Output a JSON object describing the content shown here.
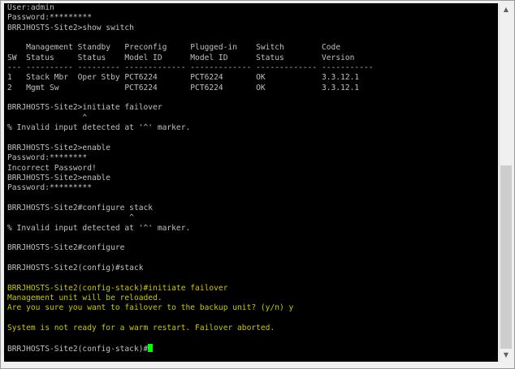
{
  "terminal": {
    "lines": [
      {
        "text": "User:admin",
        "color": "gray"
      },
      {
        "text": "Password:*********",
        "color": "gray"
      },
      {
        "text": "BRRJHOSTS-Site2>show switch",
        "color": "gray"
      },
      {
        "text": "",
        "color": "gray"
      },
      {
        "text": "    Management Standby   Preconfig     Plugged-in    Switch        Code",
        "color": "gray"
      },
      {
        "text": "SW  Status     Status    Model ID      Model ID      Status        Version",
        "color": "gray"
      },
      {
        "text": "--- ---------- --------- ------------- ------------- ------------- -----------",
        "color": "gray"
      },
      {
        "text": "1   Stack Mbr  Oper Stby PCT6224       PCT6224       OK            3.3.12.1",
        "color": "gray"
      },
      {
        "text": "2   Mgmt Sw              PCT6224       PCT6224       OK            3.3.12.1",
        "color": "gray"
      },
      {
        "text": "",
        "color": "gray"
      },
      {
        "text": "BRRJHOSTS-Site2>initiate failover",
        "color": "gray"
      },
      {
        "text": "                ^",
        "color": "gray"
      },
      {
        "text": "% Invalid input detected at '^' marker.",
        "color": "gray"
      },
      {
        "text": "",
        "color": "gray"
      },
      {
        "text": "BRRJHOSTS-Site2>enable",
        "color": "gray"
      },
      {
        "text": "Password:********",
        "color": "gray"
      },
      {
        "text": "Incorrect Password!",
        "color": "gray"
      },
      {
        "text": "BRRJHOSTS-Site2>enable",
        "color": "gray"
      },
      {
        "text": "Password:*********",
        "color": "gray"
      },
      {
        "text": "",
        "color": "gray"
      },
      {
        "text": "BRRJHOSTS-Site2#configure stack",
        "color": "gray"
      },
      {
        "text": "                          ^",
        "color": "gray"
      },
      {
        "text": "% Invalid input detected at '^' marker.",
        "color": "gray"
      },
      {
        "text": "",
        "color": "gray"
      },
      {
        "text": "BRRJHOSTS-Site2#configure",
        "color": "gray"
      },
      {
        "text": "",
        "color": "gray"
      },
      {
        "text": "BRRJHOSTS-Site2(config)#stack",
        "color": "gray"
      },
      {
        "text": "",
        "color": "gray"
      },
      {
        "text": "BRRJHOSTS-Site2(config-stack)#initiate failover",
        "color": "yellow"
      },
      {
        "text": "Management unit will be reloaded.",
        "color": "yellow"
      },
      {
        "text": "Are you sure you want to failover to the backup unit? (y/n) y",
        "color": "yellow"
      },
      {
        "text": "",
        "color": "yellow"
      },
      {
        "text": "System is not ready for a warm restart. Failover aborted.",
        "color": "yellow"
      },
      {
        "text": "",
        "color": "gray"
      },
      {
        "text": "BRRJHOSTS-Site2(config-stack)#",
        "color": "gray",
        "cursor": true
      }
    ]
  },
  "scrollbar": {
    "position_fraction": 1.0,
    "thumb_fraction": 0.55
  },
  "colors": {
    "background": "#000000",
    "text_gray": "#c0c0c0",
    "text_yellow": "#c8c800",
    "cursor": "#00ff00"
  }
}
